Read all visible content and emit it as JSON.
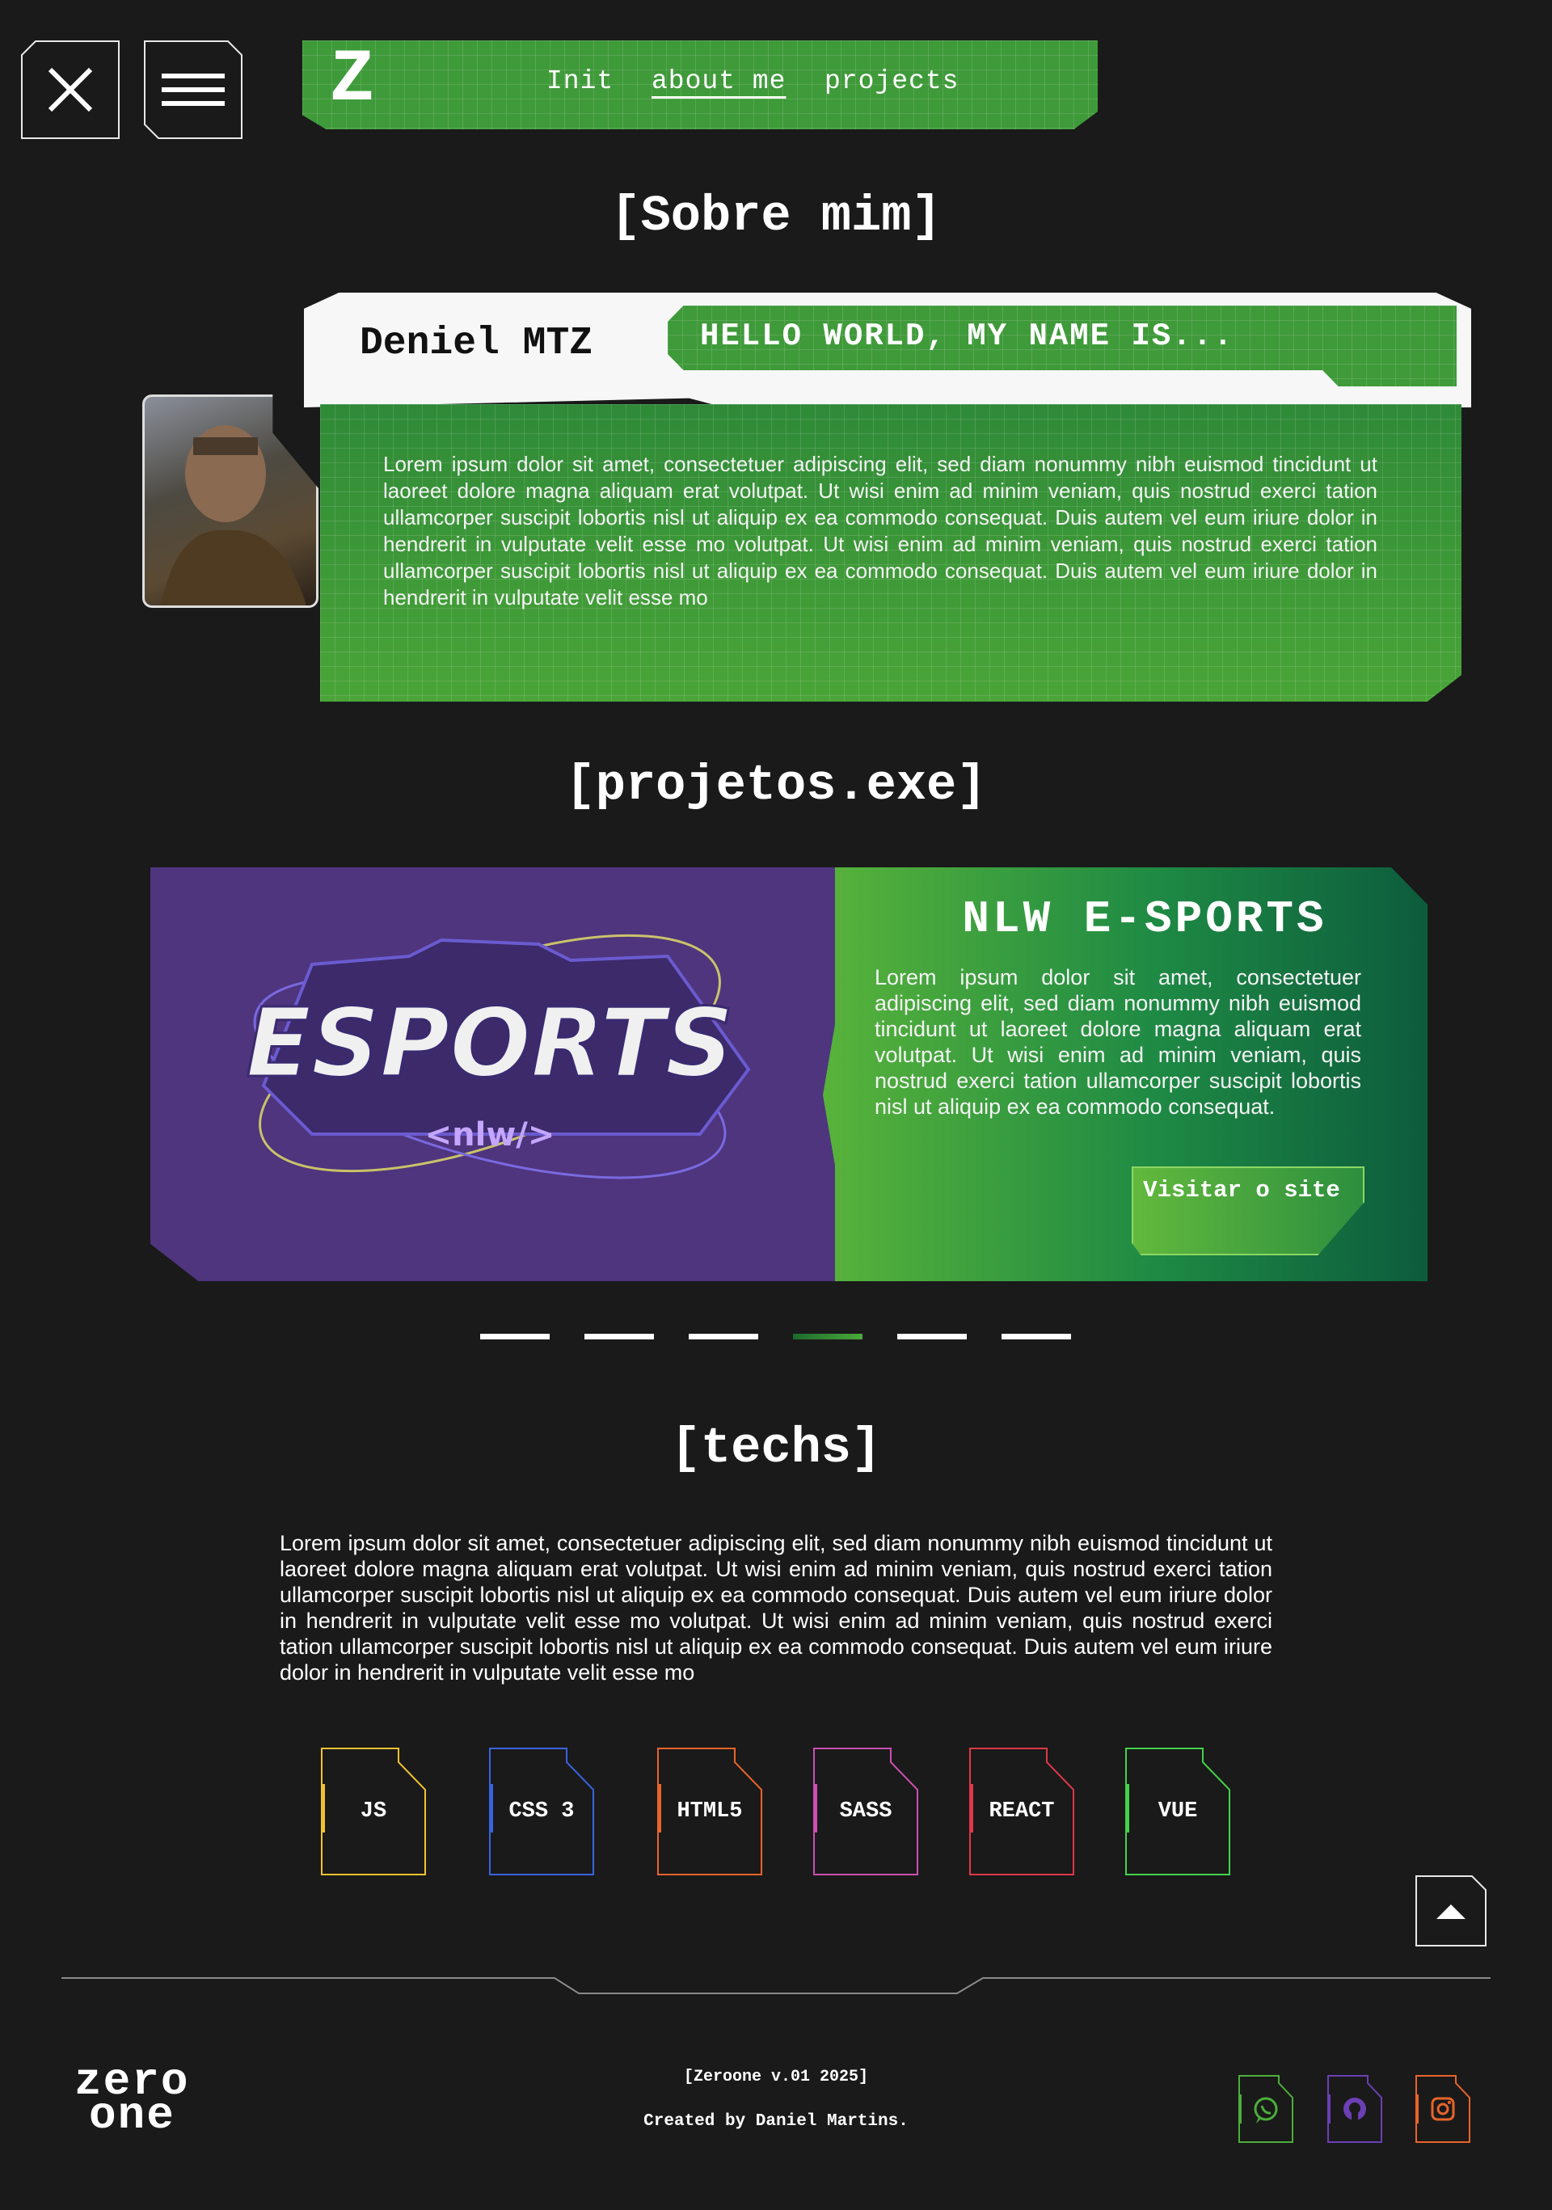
{
  "header": {
    "close_icon": "close-icon",
    "menu_icon": "hamburger-menu-icon",
    "logo_letter": "Z",
    "nav": [
      {
        "label": "Init",
        "active": false
      },
      {
        "label": "about me",
        "active": true
      },
      {
        "label": "projects",
        "active": false
      }
    ]
  },
  "about": {
    "section_title": "[Sobre mim]",
    "name": "Deniel MTZ",
    "greeting": "HELLO WORLD, MY NAME IS...",
    "text": "Lorem ipsum dolor sit amet, consectetuer adipiscing elit, sed diam nonummy nibh euismod tincidunt ut laoreet dolore magna aliquam erat volutpat. Ut wisi enim ad minim veniam, quis nostrud exerci tation ullamcorper suscipit lobortis nisl ut aliquip ex ea commodo consequat. Duis autem vel eum iriure dolor in hendrerit in vulputate velit esse mo volutpat. Ut wisi enim ad minim veniam, quis nostrud exerci tation ullamcorper suscipit lobortis nisl ut aliquip ex ea commodo consequat. Duis autem vel eum iriure dolor in hendrerit in vulputate velit esse mo"
  },
  "projects": {
    "section_title": "[projetos.exe]",
    "banner_word": "ESPORTS",
    "banner_tag": "<nlw/>",
    "title": "NLW E-SPORTS",
    "description": "Lorem ipsum dolor sit amet, consectetuer adipiscing elit, sed diam nonummy nibh euismod tincidunt ut laoreet dolore magna aliquam erat volutpat. Ut wisi enim ad minim veniam, quis nostrud exerci tation ullamcorper suscipit lobortis nisl ut aliquip ex ea commodo consequat.",
    "visit_label": "Visitar o site",
    "carousel": {
      "count": 6,
      "active_index": 3
    }
  },
  "techs": {
    "section_title": "[techs]",
    "text": "Lorem ipsum dolor sit amet, consectetuer adipiscing elit, sed diam nonummy nibh euismod tincidunt ut laoreet dolore magna aliquam erat volutpat. Ut wisi enim ad minim veniam, quis nostrud exerci tation ullamcorper suscipit lobortis nisl ut aliquip ex ea commodo consequat. Duis autem vel eum iriure dolor in hendrerit in vulputate velit esse mo volutpat. Ut wisi enim ad minim veniam, quis nostrud exerci tation ullamcorper suscipit lobortis nisl ut aliquip ex ea commodo consequat. Duis autem vel eum iriure dolor in hendrerit in vulputate velit esse mo",
    "items": [
      {
        "label": "JS",
        "color": "#f2c230"
      },
      {
        "label": "CSS 3",
        "color": "#3a63e0"
      },
      {
        "label": "HTML5",
        "color": "#e8642a"
      },
      {
        "label": "SASS",
        "color": "#cc4fb0"
      },
      {
        "label": "REACT",
        "color": "#e0374a"
      },
      {
        "label": "VUE",
        "color": "#43d24a"
      }
    ]
  },
  "footer": {
    "logo_line1": "zero",
    "logo_line2": "one",
    "version": "[Zeroone v.01 2025]",
    "credit": "Created by Daniel Martins.",
    "socials": [
      {
        "name": "whatsapp-icon",
        "color": "#4caf3a"
      },
      {
        "name": "github-icon",
        "color": "#6b3fb5"
      },
      {
        "name": "instagram-icon",
        "color": "#e8642a"
      }
    ]
  },
  "colors": {
    "background": "#1a1a1a",
    "accent_green": "#3f9a3a",
    "project_purple": "#4e357e"
  }
}
